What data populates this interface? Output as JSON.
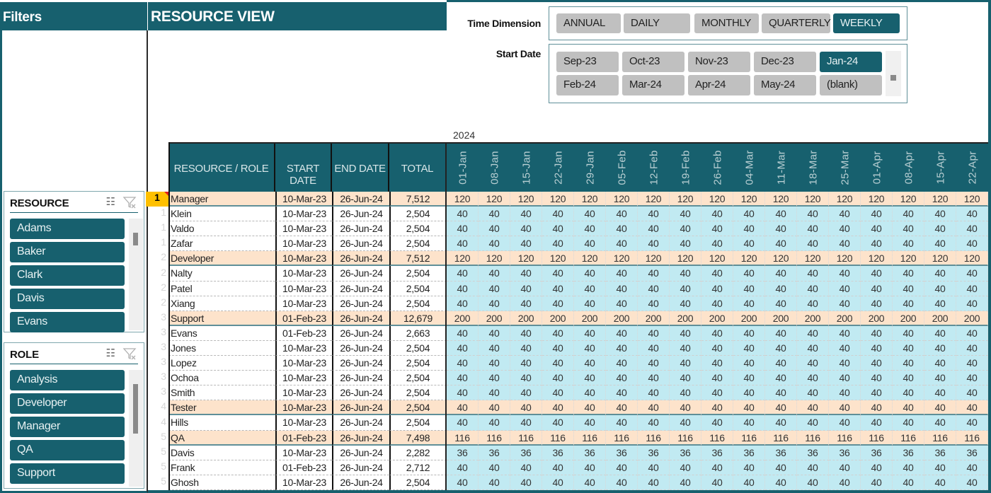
{
  "filters": {
    "title": "Filters",
    "resource_slicer": {
      "title": "RESOURCE",
      "multiselect_icon": "multi-select-icon",
      "clear_icon": "clear-filter-icon",
      "items": [
        "Adams",
        "Baker",
        "Clark",
        "Davis",
        "Evans"
      ]
    },
    "role_slicer": {
      "title": "ROLE",
      "multiselect_icon": "multi-select-icon",
      "clear_icon": "clear-filter-icon",
      "items": [
        "Analysis",
        "Developer",
        "Manager",
        "QA",
        "Support"
      ]
    }
  },
  "view": {
    "title": "RESOURCE VIEW",
    "time_dimension": {
      "label": "Time Dimension",
      "options": [
        "ANNUAL",
        "DAILY",
        "MONTHLY",
        "QUARTERLY",
        "WEEKLY"
      ],
      "selected": "WEEKLY"
    },
    "start_date": {
      "label": "Start Date",
      "options": [
        "Sep-23",
        "Oct-23",
        "Nov-23",
        "Dec-23",
        "Jan-24",
        "Feb-24",
        "Mar-24",
        "Apr-24",
        "May-24",
        "(blank)"
      ],
      "selected": "Jan-24"
    },
    "year": "2024",
    "colors": {
      "teal": "#17606e",
      "role_row": "#fde3cb",
      "value_cell": "#c1eaf2",
      "selected_index": "#ffc000"
    }
  },
  "grid": {
    "headers": {
      "resource_role": "RESOURCE / ROLE",
      "start_date": "START DATE",
      "end_date": "END DATE",
      "total": "TOTAL"
    },
    "weeks": [
      "01-Jan",
      "08-Jan",
      "15-Jan",
      "22-Jan",
      "29-Jan",
      "05-Feb",
      "12-Feb",
      "19-Feb",
      "26-Feb",
      "04-Mar",
      "11-Mar",
      "18-Mar",
      "25-Mar",
      "01-Apr",
      "08-Apr",
      "15-Apr",
      "22-Apr"
    ],
    "rows": [
      {
        "idx": "1",
        "type": "role",
        "name": "Manager",
        "start": "10-Mar-23",
        "end": "26-Jun-24",
        "total": "7,512",
        "weekly": 120,
        "active": true
      },
      {
        "idx": "1",
        "type": "person",
        "name": "Klein",
        "start": "10-Mar-23",
        "end": "26-Jun-24",
        "total": "2,504",
        "weekly": 40
      },
      {
        "idx": "1",
        "type": "person",
        "name": "Valdo",
        "start": "10-Mar-23",
        "end": "26-Jun-24",
        "total": "2,504",
        "weekly": 40
      },
      {
        "idx": "1",
        "type": "person",
        "name": "Zafar",
        "start": "10-Mar-23",
        "end": "26-Jun-24",
        "total": "2,504",
        "weekly": 40
      },
      {
        "idx": "2",
        "type": "role",
        "name": "Developer",
        "start": "10-Mar-23",
        "end": "26-Jun-24",
        "total": "7,512",
        "weekly": 120
      },
      {
        "idx": "2",
        "type": "person",
        "name": "Nalty",
        "start": "10-Mar-23",
        "end": "26-Jun-24",
        "total": "2,504",
        "weekly": 40
      },
      {
        "idx": "2",
        "type": "person",
        "name": "Patel",
        "start": "10-Mar-23",
        "end": "26-Jun-24",
        "total": "2,504",
        "weekly": 40
      },
      {
        "idx": "2",
        "type": "person",
        "name": "Xiang",
        "start": "10-Mar-23",
        "end": "26-Jun-24",
        "total": "2,504",
        "weekly": 40
      },
      {
        "idx": "3",
        "type": "role",
        "name": "Support",
        "start": "01-Feb-23",
        "end": "26-Jun-24",
        "total": "12,679",
        "weekly": 200
      },
      {
        "idx": "3",
        "type": "person",
        "name": "Evans",
        "start": "01-Feb-23",
        "end": "26-Jun-24",
        "total": "2,663",
        "weekly": 40
      },
      {
        "idx": "3",
        "type": "person",
        "name": "Jones",
        "start": "10-Mar-23",
        "end": "26-Jun-24",
        "total": "2,504",
        "weekly": 40
      },
      {
        "idx": "3",
        "type": "person",
        "name": "Lopez",
        "start": "10-Mar-23",
        "end": "26-Jun-24",
        "total": "2,504",
        "weekly": 40
      },
      {
        "idx": "3",
        "type": "person",
        "name": "Ochoa",
        "start": "10-Mar-23",
        "end": "26-Jun-24",
        "total": "2,504",
        "weekly": 40
      },
      {
        "idx": "3",
        "type": "person",
        "name": "Smith",
        "start": "10-Mar-23",
        "end": "26-Jun-24",
        "total": "2,504",
        "weekly": 40
      },
      {
        "idx": "4",
        "type": "role",
        "name": "Tester",
        "start": "10-Mar-23",
        "end": "26-Jun-24",
        "total": "2,504",
        "weekly": 40
      },
      {
        "idx": "4",
        "type": "person",
        "name": "Hills",
        "start": "10-Mar-23",
        "end": "26-Jun-24",
        "total": "2,504",
        "weekly": 40
      },
      {
        "idx": "5",
        "type": "role",
        "name": "QA",
        "start": "01-Feb-23",
        "end": "26-Jun-24",
        "total": "7,498",
        "weekly": 116
      },
      {
        "idx": "5",
        "type": "person",
        "name": "Davis",
        "start": "10-Mar-23",
        "end": "26-Jun-24",
        "total": "2,282",
        "weekly": 36
      },
      {
        "idx": "5",
        "type": "person",
        "name": "Frank",
        "start": "01-Feb-23",
        "end": "26-Jun-24",
        "total": "2,712",
        "weekly": 40
      },
      {
        "idx": "5",
        "type": "person",
        "name": "Ghosh",
        "start": "10-Mar-23",
        "end": "26-Jun-24",
        "total": "2,504",
        "weekly": 40
      }
    ]
  }
}
